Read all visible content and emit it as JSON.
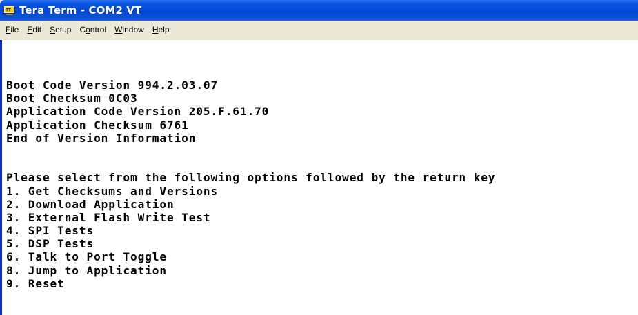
{
  "window": {
    "title": "Tera Term - COM2 VT",
    "icon": "tera-term-app-icon"
  },
  "menu": [
    {
      "pre": "",
      "acc": "F",
      "post": "ile"
    },
    {
      "pre": "",
      "acc": "E",
      "post": "dit"
    },
    {
      "pre": "",
      "acc": "S",
      "post": "etup"
    },
    {
      "pre": "C",
      "acc": "o",
      "post": "ntrol"
    },
    {
      "pre": "",
      "acc": "W",
      "post": "indow"
    },
    {
      "pre": "",
      "acc": "H",
      "post": "elp"
    }
  ],
  "terminal": {
    "version_block": [
      "Boot Code Version 994.2.03.07",
      "Boot Checksum 0C03",
      "Application Code Version 205.F.61.70",
      "Application Checksum 6761",
      "End of Version Information"
    ],
    "options_block": [
      "Please select from the following options followed by the return key",
      "1. Get Checksums and Versions",
      "2. Download Application",
      "3. External Flash Write Test",
      "4. SPI Tests",
      "5. DSP Tests",
      "6. Talk to Port Toggle",
      "8. Jump to Application",
      "9. Reset"
    ]
  },
  "colors": {
    "titlebar": "#0248d4",
    "title_text": "#ffffff",
    "menubar": "#ece9d8",
    "terminal_bg": "#ffffff",
    "terminal_text": "#000000"
  }
}
